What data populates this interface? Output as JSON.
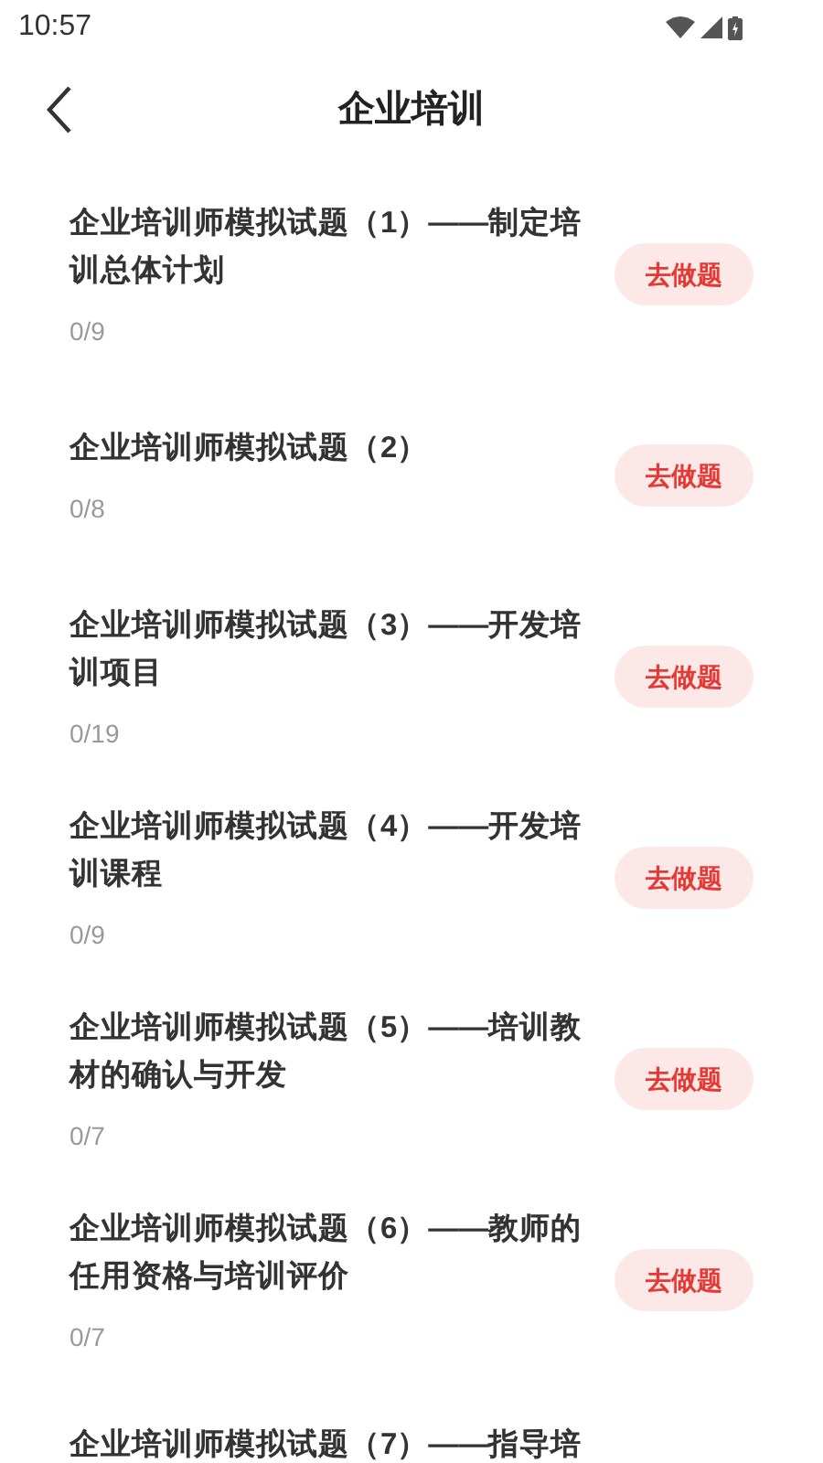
{
  "status_bar": {
    "time": "10:57"
  },
  "header": {
    "title": "企业培训"
  },
  "items": [
    {
      "title": "企业培训师模拟试题（1）——制定培训总体计划",
      "progress": "0/9",
      "action": "去做题"
    },
    {
      "title": "企业培训师模拟试题（2）",
      "progress": "0/8",
      "action": "去做题"
    },
    {
      "title": "企业培训师模拟试题（3）——开发培训项目",
      "progress": "0/19",
      "action": "去做题"
    },
    {
      "title": "企业培训师模拟试题（4）——开发培训课程",
      "progress": "0/9",
      "action": "去做题"
    },
    {
      "title": "企业培训师模拟试题（5）——培训教材的确认与开发",
      "progress": "0/7",
      "action": "去做题"
    },
    {
      "title": "企业培训师模拟试题（6）——教师的任用资格与培训评价",
      "progress": "0/7",
      "action": "去做题"
    },
    {
      "title": "企业培训师模拟试题（7）——指导培"
    }
  ]
}
